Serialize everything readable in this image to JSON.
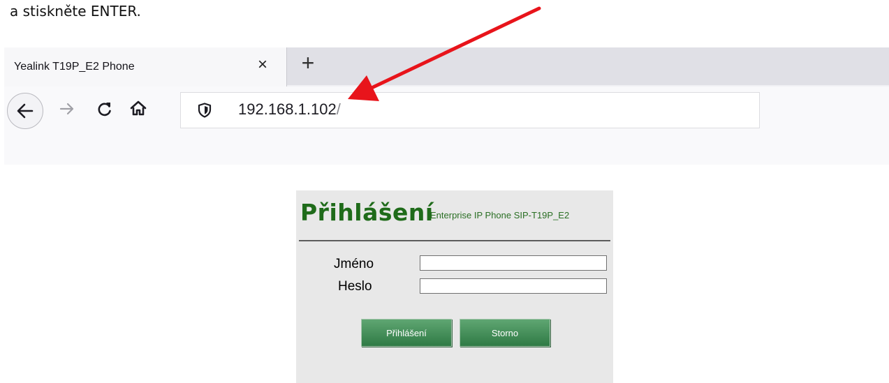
{
  "instruction": "a stiskněte ENTER.",
  "browser": {
    "tab_title": "Yealink T19P_E2 Phone",
    "tab_close": "×",
    "new_tab": "+",
    "url_main": "192.168.1.102",
    "url_slash": "/"
  },
  "icons": {
    "back": "back-arrow-icon",
    "forward": "forward-arrow-icon",
    "reload": "reload-icon",
    "home": "home-icon",
    "shield": "shield-icon",
    "annotation": "red-arrow-annotation"
  },
  "login": {
    "title": "Přihlášení",
    "device": "Enterprise IP Phone SIP-T19P_E2",
    "user_label": "Jméno",
    "pass_label": "Heslo",
    "user_value": "",
    "pass_value": "",
    "submit_label": "Přihlášení",
    "cancel_label": "Storno"
  },
  "colors": {
    "brand_green": "#1f6b1a",
    "button_green": "#2f7a45",
    "annotation_red": "#e8141b"
  }
}
